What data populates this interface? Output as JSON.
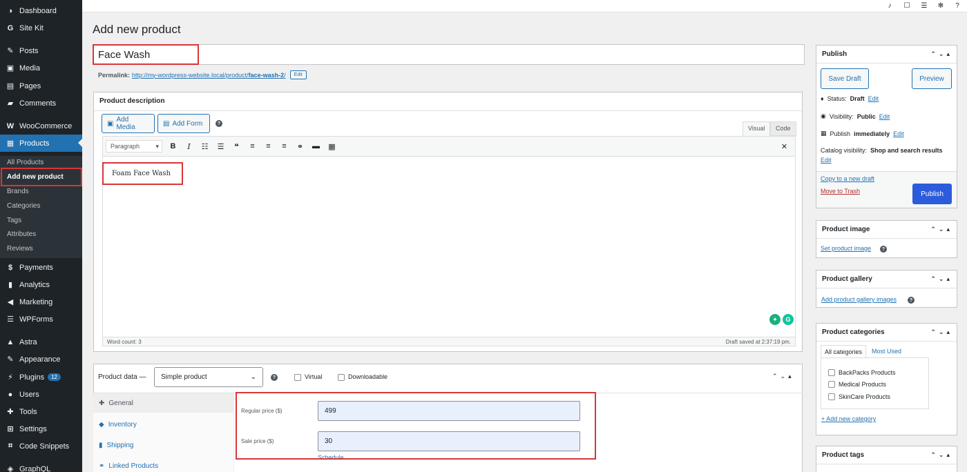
{
  "sidebar": {
    "items": [
      {
        "label": "Dashboard",
        "icon": "dashboard-icon"
      },
      {
        "label": "Site Kit",
        "icon": "google-g-icon"
      },
      {
        "label": "Posts",
        "icon": "pin-icon"
      },
      {
        "label": "Media",
        "icon": "media-icon"
      },
      {
        "label": "Pages",
        "icon": "page-icon"
      },
      {
        "label": "Comments",
        "icon": "comment-icon"
      },
      {
        "label": "WooCommerce",
        "icon": "woo-icon"
      },
      {
        "label": "Products",
        "icon": "products-icon"
      },
      {
        "label": "Payments",
        "icon": "payments-icon"
      },
      {
        "label": "Analytics",
        "icon": "analytics-icon"
      },
      {
        "label": "Marketing",
        "icon": "megaphone-icon"
      },
      {
        "label": "WPForms",
        "icon": "wpforms-icon"
      },
      {
        "label": "Astra",
        "icon": "astra-icon"
      },
      {
        "label": "Appearance",
        "icon": "brush-icon"
      },
      {
        "label": "Plugins",
        "icon": "plug-icon",
        "badge": "12"
      },
      {
        "label": "Users",
        "icon": "user-icon"
      },
      {
        "label": "Tools",
        "icon": "wrench-icon"
      },
      {
        "label": "Settings",
        "icon": "settings-icon"
      },
      {
        "label": "Code Snippets",
        "icon": "code-icon"
      },
      {
        "label": "GraphQL",
        "icon": "graphql-icon"
      }
    ],
    "submenu": [
      "All Products",
      "Add new product",
      "Brands",
      "Categories",
      "Tags",
      "Attributes",
      "Reviews"
    ]
  },
  "page": {
    "title": "Add new product",
    "product_title": "Face Wash",
    "permalink_label": "Permalink:",
    "permalink_base": "http://my-wordpress-website.local/product/",
    "permalink_slug": "face-wash-2",
    "permalink_tail": "/",
    "permalink_edit": "Edit"
  },
  "description": {
    "heading": "Product description",
    "add_media": "Add Media",
    "add_form": "Add Form",
    "tab_visual": "Visual",
    "tab_code": "Code",
    "format_select": "Paragraph",
    "content": "Foam Face Wash",
    "word_count": "Word count: 3",
    "draft_saved": "Draft saved at 2:37:19 pm."
  },
  "product_data": {
    "label": "Product data —",
    "type": "Simple product",
    "virtual": "Virtual",
    "downloadable": "Downloadable",
    "tabs": [
      "General",
      "Inventory",
      "Shipping",
      "Linked Products"
    ],
    "regular_price_label": "Regular price ($)",
    "regular_price": "499",
    "sale_price_label": "Sale price ($)",
    "sale_price": "30",
    "schedule": "Schedule"
  },
  "publish": {
    "heading": "Publish",
    "save_draft": "Save Draft",
    "preview": "Preview",
    "status_label": "Status:",
    "status_value": "Draft",
    "visibility_label": "Visibility:",
    "visibility_value": "Public",
    "publish_label": "Publish",
    "publish_value": "immediately",
    "catalog_label": "Catalog visibility:",
    "catalog_value": "Shop and search results",
    "edit": "Edit",
    "copy_draft": "Copy to a new draft",
    "trash": "Move to Trash",
    "publish_button": "Publish"
  },
  "product_image": {
    "heading": "Product image",
    "link": "Set product image"
  },
  "product_gallery": {
    "heading": "Product gallery",
    "link": "Add product gallery images"
  },
  "product_categories": {
    "heading": "Product categories",
    "tab_all": "All categories",
    "tab_most": "Most Used",
    "items": [
      "BackPacks Products",
      "Medical Products",
      "SkinCare Products"
    ],
    "add_new": "+ Add new category"
  },
  "product_tags": {
    "heading": "Product tags"
  },
  "colors": {
    "accent": "#2271b1",
    "sidebar": "#1d2327",
    "highlight": "#d63638",
    "publish": "#2c5cdb"
  }
}
